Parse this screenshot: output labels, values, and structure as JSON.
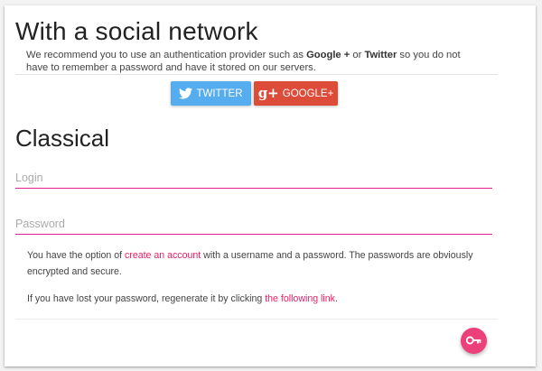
{
  "social": {
    "title": "With a social network",
    "intro": {
      "part1": "We recommend you to use an authentication provider such as ",
      "google": "Google +",
      "part2": " or ",
      "twitter": "Twitter",
      "part3": " so you do not have to remember a password and have it stored on our servers."
    },
    "twitter_button": "TWITTER",
    "google_button": "GOOGLE+",
    "google_glyph": "g+",
    "twitter_color": "#55acee",
    "google_color": "#dd4b39"
  },
  "classical": {
    "title": "Classical",
    "login_placeholder": "Login",
    "password_placeholder": "Password",
    "paragraph1": {
      "before": "You have the option of ",
      "link": "create an account",
      "after": " with a username and a password. The passwords are obviously encrypted and secure."
    },
    "paragraph2": {
      "before": "If you have lost your password, regenerate it by clicking ",
      "link": "the following link",
      "after": "."
    },
    "accent_color": "#e91e63"
  },
  "fab": {
    "icon": "key-icon"
  }
}
